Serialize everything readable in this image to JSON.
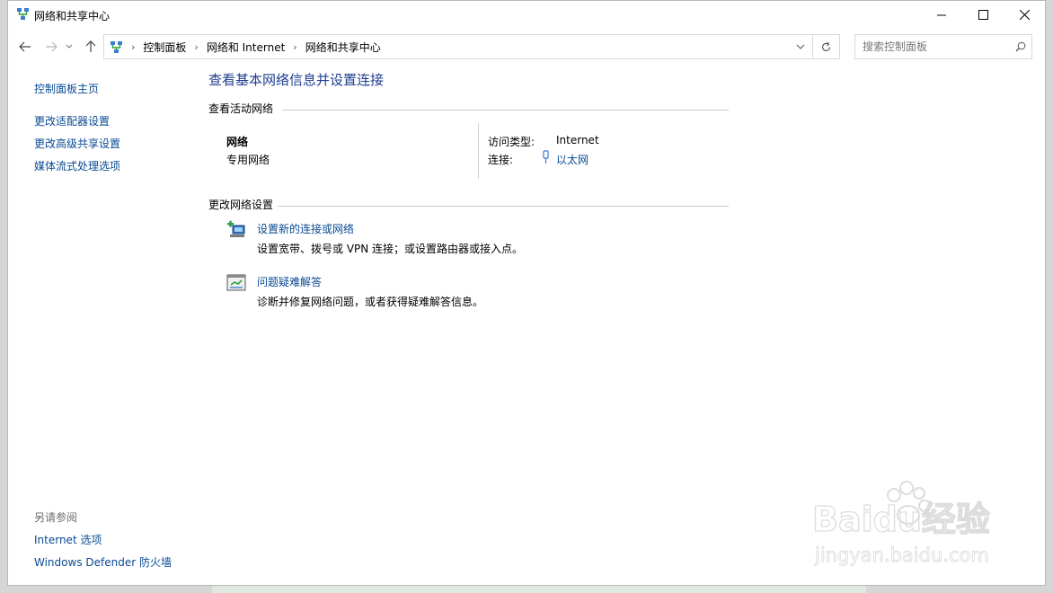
{
  "window": {
    "title": "网络和共享中心"
  },
  "address": {
    "crumbs": [
      "控制面板",
      "网络和 Internet",
      "网络和共享中心"
    ]
  },
  "search": {
    "placeholder": "搜索控制面板"
  },
  "left": {
    "home": "控制面板主页",
    "links": [
      "更改适配器设置",
      "更改高级共享设置",
      "媒体流式处理选项"
    ],
    "see_also_title": "另请参阅",
    "see_also": [
      "Internet 选项",
      "Windows Defender 防火墙"
    ]
  },
  "main": {
    "heading": "查看基本网络信息并设置连接",
    "active_title": "查看活动网络",
    "network": {
      "name": "网络",
      "category": "专用网络",
      "access_label": "访问类型:",
      "access_value": "Internet",
      "conn_label": "连接:",
      "conn_value": "以太网"
    },
    "change_title": "更改网络设置",
    "tasks": [
      {
        "title": "设置新的连接或网络",
        "desc": "设置宽带、拨号或 VPN 连接；或设置路由器或接入点。",
        "icon": "new-connection-icon"
      },
      {
        "title": "问题疑难解答",
        "desc": "诊断并修复网络问题，或者获得疑难解答信息。",
        "icon": "troubleshoot-icon"
      }
    ]
  },
  "watermark": {
    "brand": "Baidu经验",
    "url": "jingyan.baidu.com"
  },
  "colors": {
    "link": "#0a4a93",
    "heading": "#1e3d8f"
  }
}
